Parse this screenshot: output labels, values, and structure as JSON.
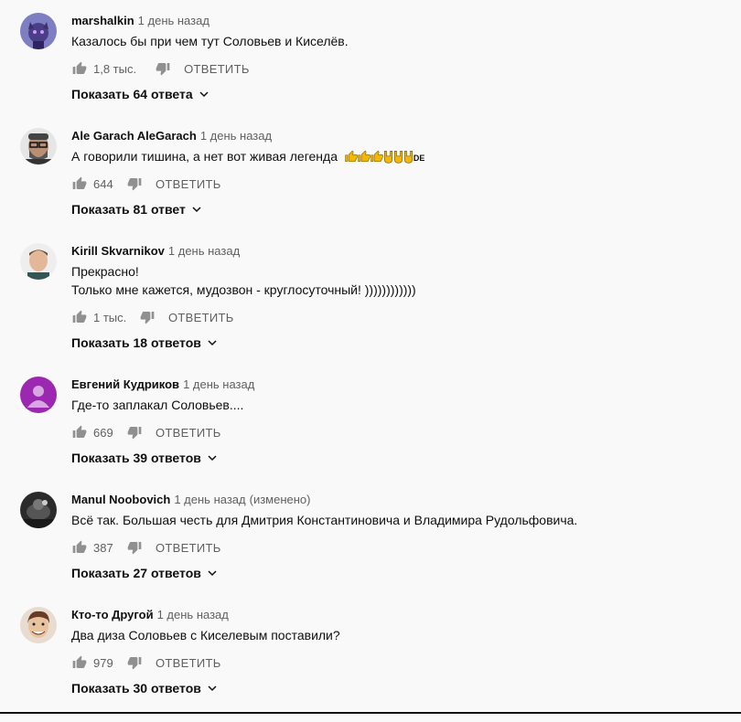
{
  "comments": [
    {
      "author": "marshalkin",
      "time": "1 день назад",
      "edited": "",
      "text": [
        "Казалось бы при чем тут Соловьев и Киселёв."
      ],
      "emoji_suffix": "",
      "likes": "1,8 тыс.",
      "reply_label": "ОТВЕТИТЬ",
      "replies_label": "Показать 64 ответа",
      "avatar_color": "#6b5fa8"
    },
    {
      "author": "Ale Garach AleGarach",
      "time": "1 день назад",
      "edited": "",
      "text": [
        "А говорили тишина, а нет вот живая легенда"
      ],
      "emoji_suffix": "DE",
      "likes": "644",
      "reply_label": "ОТВЕТИТЬ",
      "replies_label": "Показать 81 ответ",
      "avatar_color": "#8a8a8a"
    },
    {
      "author": "Kirill Skvarnikov",
      "time": "1 день назад",
      "edited": "",
      "text": [
        "Прекрасно!",
        "Только мне кажется, мудозвон - круглосуточный!  ))))))))))))"
      ],
      "emoji_suffix": "",
      "likes": "1 тыс.",
      "reply_label": "ОТВЕТИТЬ",
      "replies_label": "Показать 18 ответов",
      "avatar_color": "#c9b7a6"
    },
    {
      "author": "Евгений Кудриков",
      "time": "1 день назад",
      "edited": "",
      "text": [
        "Где-то заплакал Соловьев...."
      ],
      "emoji_suffix": "",
      "likes": "669",
      "reply_label": "ОТВЕТИТЬ",
      "replies_label": "Показать 39 ответов",
      "avatar_color": "#9c27b0"
    },
    {
      "author": "Manul Noobovich",
      "time": "1 день назад",
      "edited": "(изменено)",
      "text": [
        "Всё так. Большая честь для Дмитрия Константиновича и Владимира Рудольфовича."
      ],
      "emoji_suffix": "",
      "likes": "387",
      "reply_label": "ОТВЕТИТЬ",
      "replies_label": "Показать 27 ответов",
      "avatar_color": "#3a3a3a"
    },
    {
      "author": "Кто-то Другой",
      "time": "1 день назад",
      "edited": "",
      "text": [
        "Два диза Соловьев с Киселевым поставили?"
      ],
      "emoji_suffix": "",
      "likes": "979",
      "reply_label": "ОТВЕТИТЬ",
      "replies_label": "Показать 30 ответов",
      "avatar_color": "#d9c4b0"
    }
  ],
  "icons": {
    "like": "thumb-up-icon",
    "dislike": "thumb-down-icon",
    "expand": "chevron-down-icon"
  }
}
